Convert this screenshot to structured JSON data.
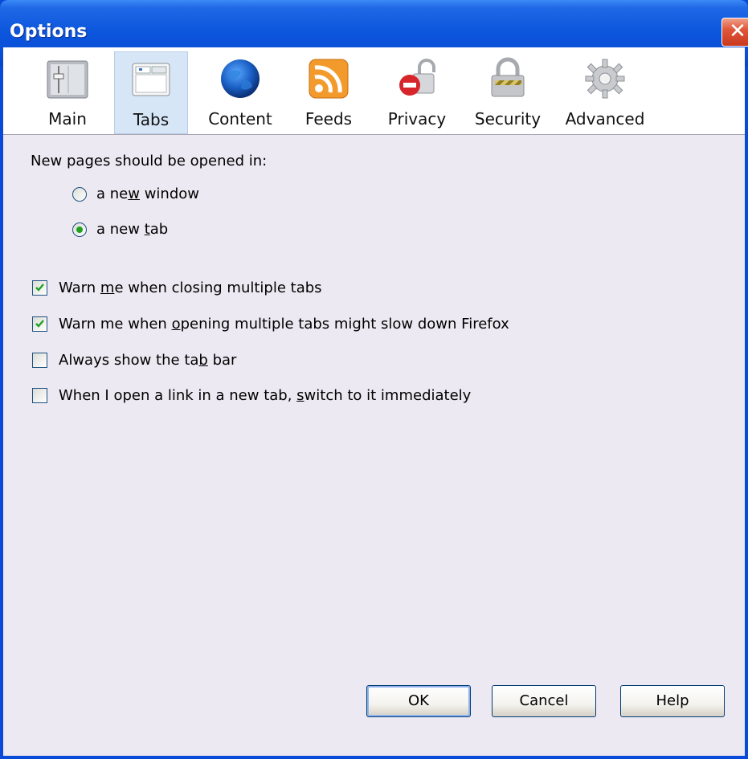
{
  "window": {
    "title": "Options"
  },
  "toolbar": {
    "panes": [
      {
        "label": "Main",
        "icon": "main-panel-icon",
        "selected": false
      },
      {
        "label": "Tabs",
        "icon": "tabs-window-icon",
        "selected": true
      },
      {
        "label": "Content",
        "icon": "globe-icon",
        "selected": false
      },
      {
        "label": "Feeds",
        "icon": "rss-feed-icon",
        "selected": false
      },
      {
        "label": "Privacy",
        "icon": "privacy-lock-icon",
        "selected": false
      },
      {
        "label": "Security",
        "icon": "security-padlock-icon",
        "selected": false
      },
      {
        "label": "Advanced",
        "icon": "gear-icon",
        "selected": false
      }
    ]
  },
  "tabs_pane": {
    "open_in_label": "New pages should be opened in:",
    "open_in_options": [
      {
        "pre": "a ne",
        "key": "w",
        "post": " window",
        "selected": false
      },
      {
        "pre": "a new ",
        "key": "t",
        "post": "ab",
        "selected": true
      }
    ],
    "checkboxes": [
      {
        "pre": "Warn ",
        "key": "m",
        "post": "e when closing multiple tabs",
        "checked": true
      },
      {
        "pre": "Warn me when ",
        "key": "o",
        "post": "pening multiple tabs might slow down Firefox",
        "checked": true
      },
      {
        "pre": "Always show the ta",
        "key": "b",
        "post": " bar",
        "checked": false
      },
      {
        "pre": "When I open a link in a new tab, ",
        "key": "s",
        "post": "witch to it immediately",
        "checked": false
      }
    ]
  },
  "buttons": {
    "ok": "OK",
    "cancel": "Cancel",
    "help": "Help"
  },
  "colors": {
    "titlebar": "#0a4ed6",
    "client": "#ede9f2",
    "selected_pane": "#d6e6f7",
    "close": "#e0573a"
  }
}
